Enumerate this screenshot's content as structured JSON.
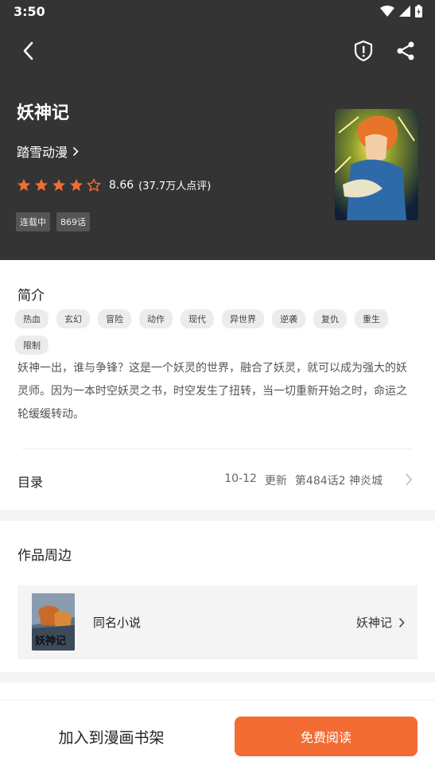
{
  "status_bar": {
    "time": "3:50"
  },
  "header": {
    "back_icon": "chevron-left-icon",
    "report_icon": "shield-alert-icon",
    "share_icon": "share-icon"
  },
  "comic": {
    "title": "妖神记",
    "author": "踏雪动漫",
    "rating": {
      "stars_filled": 4.5,
      "stars_total": 5,
      "score": "8.66",
      "count": "(37.7万人点评)"
    },
    "badges": [
      "连载中",
      "869话"
    ],
    "cover_icon": "comic-cover-image"
  },
  "intro": {
    "heading": "简介",
    "tags": [
      "热血",
      "玄幻",
      "冒险",
      "动作",
      "现代",
      "异世界",
      "逆袭",
      "复仇",
      "重生",
      "限制"
    ],
    "description": "妖神一出，谁与争锋？这是一个妖灵的世界，融合了妖灵，就可以成为强大的妖灵师。因为一本时空妖灵之书，时空发生了扭转，当一切重新开始之时，命运之轮缓缓转动。"
  },
  "toc": {
    "label": "目录",
    "date": "10-12",
    "update": "更新",
    "latest": "第484话2 神炎城"
  },
  "peripheral": {
    "heading": "作品周边",
    "novel_label": "同名小说",
    "novel_title": "妖神记"
  },
  "bottom": {
    "shelf_label": "加入到漫画书架",
    "read_label": "免费阅读"
  },
  "colors": {
    "accent": "#f36c34",
    "header_bg": "#343434"
  }
}
